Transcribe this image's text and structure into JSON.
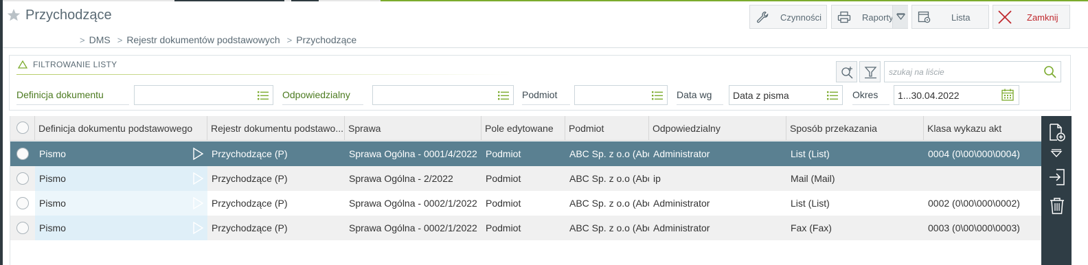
{
  "header": {
    "title": "Przychodzące",
    "breadcrumb": [
      "DMS",
      "Rejestr dokumentów podstawowych",
      "Przychodzące"
    ]
  },
  "toolbar": {
    "actions_label": "Czynności",
    "reports_label": "Raporty",
    "list_label": "Lista",
    "close_label": "Zamknij"
  },
  "filters": {
    "section_title": "FILTROWANIE LISTY",
    "search_placeholder": "szukaj na liście",
    "definition_label": "Definicja dokumentu",
    "definition_value": "",
    "responsible_label": "Odpowiedzialny",
    "responsible_value": "",
    "subject_label": "Podmiot",
    "subject_value": "",
    "date_by_label": "Data wg",
    "date_by_value": "Data z pisma",
    "period_label": "Okres",
    "period_value": "1...30.04.2022"
  },
  "table": {
    "columns": [
      "Definicja dokumentu podstawowego",
      "Rejestr dokumentu podstawo...",
      "Sprawa",
      "Pole edytowane",
      "Podmiot",
      "Odpowiedzialny",
      "Sposób przekazania",
      "Klasa wykazu akt"
    ],
    "rows": [
      [
        "Pismo",
        "Przychodzące (P)",
        "Sprawa Ogólna - 0001/4/2022",
        "Podmiot",
        "ABC Sp. z o.o (Abc)",
        "Administrator",
        "List (List)",
        "0004 (0\\00\\000\\0004)"
      ],
      [
        "Pismo",
        "Przychodzące (P)",
        "Sprawa Ogólna - 2/2022",
        "Podmiot",
        "ABC Sp. z o.o (Abc)",
        "ip",
        "Mail (Mail)",
        ""
      ],
      [
        "Pismo",
        "Przychodzące (P)",
        "Sprawa Ogólna - 0002/1/2022",
        "Podmiot",
        "ABC Sp. z o.o (Abc)",
        "Administrator",
        "List (List)",
        "0002 (0\\00\\000\\0002)"
      ],
      [
        "Pismo",
        "Przychodzące (P)",
        "Sprawa Ogólna - 0002/1/2022",
        "Podmiot",
        "ABC Sp. z o.o (Abc)",
        "Administrator",
        "Fax (Fax)",
        "0003 (0\\00\\000\\0003)"
      ]
    ]
  },
  "colors": {
    "selected_row": "#5a8091",
    "accent_green": "#7cab2e",
    "close_red": "#c0282d",
    "sidebar_dark": "#2f3d45"
  },
  "icons": {
    "star": "star-icon",
    "actions": "wrench-icon",
    "reports": "printer-icon",
    "list": "list-settings-icon",
    "close": "close-x-icon",
    "filter_toggle": "triangle-up-icon",
    "zoom_plus": "search-plus-icon",
    "filter_clear": "funnel-clear-icon",
    "search": "search-icon",
    "list_picker": "list-icon",
    "calendar": "calendar-icon",
    "add_document": "add-document-icon",
    "expand": "triangle-down-icon",
    "import": "import-icon",
    "delete": "trash-icon"
  }
}
